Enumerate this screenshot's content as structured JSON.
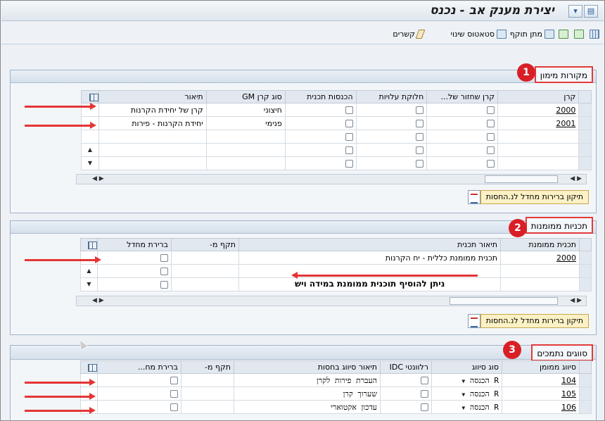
{
  "window": {
    "title": "יצירת מענק אב - נכנס"
  },
  "toolbar": {
    "links_label": "קשרים",
    "status_label": "סטאטוס שינוי",
    "validity_label": "מתן תוקף"
  },
  "section1": {
    "label": "מקורות מימון",
    "badge": "1",
    "columns": [
      "קרן",
      "קרן שחזור של...",
      "חלוקת עלויות",
      "הכנסות תכנית",
      "סוג קרן GM",
      "תיאור"
    ],
    "rows": [
      {
        "fund": "2000",
        "type": "חיצוני",
        "desc": "קרן של יחידת הקרנות"
      },
      {
        "fund": "2001",
        "type": "פנימי",
        "desc": "יחידת הקרנות - פירות"
      },
      {
        "fund": "",
        "type": "",
        "desc": ""
      },
      {
        "fund": "",
        "type": "",
        "desc": ""
      },
      {
        "fund": "",
        "type": "",
        "desc": ""
      }
    ],
    "button_label": "תיקון ברירות מחדל לנ.החסות"
  },
  "section2": {
    "label": "תכניות ממומנות",
    "badge": "2",
    "columns": [
      "תכנית ממומנת",
      "תיאור תכנית",
      "תקף מ-",
      "ברירת מחדל"
    ],
    "rows": [
      {
        "program": "2000",
        "desc": "תכנית ממומנת כללית - יח הקרנות"
      },
      {
        "program": "",
        "desc": ""
      },
      {
        "program": "",
        "desc": ""
      }
    ],
    "annotation": "ניתן להוסיף תוכנית ממומנת במידה ויש",
    "button_label": "תיקון ברירות מחדל לנ.החסות"
  },
  "section3": {
    "label": "סווגים נתמכים",
    "badge": "3",
    "columns": [
      "סיווג ממומן",
      "סוג סיווג",
      "רלוונטי IDC",
      "תיאור סיווג בחסות",
      "תקף מ-",
      "ברירת מח..."
    ],
    "rows": [
      {
        "code": "104",
        "type": "R הכנסה",
        "desc": "העברת פירות לקרן"
      },
      {
        "code": "105",
        "type": "R הכנסה",
        "desc": "שערוך קרן"
      },
      {
        "code": "106",
        "type": "R הכנסה",
        "desc": "עדכון אקטוארי"
      }
    ]
  },
  "colors": {
    "accent_red": "#d91f26",
    "button_yellow": "#fcf1c5",
    "header_bg": "#e2e8ef"
  },
  "icons": [
    "grid-icon",
    "new-doc-icon",
    "save-icon",
    "validity-icon",
    "status-icon",
    "links-icon",
    "table-settings-icon",
    "scroll-up-icon",
    "scroll-down-icon",
    "dropdown-icon"
  ]
}
